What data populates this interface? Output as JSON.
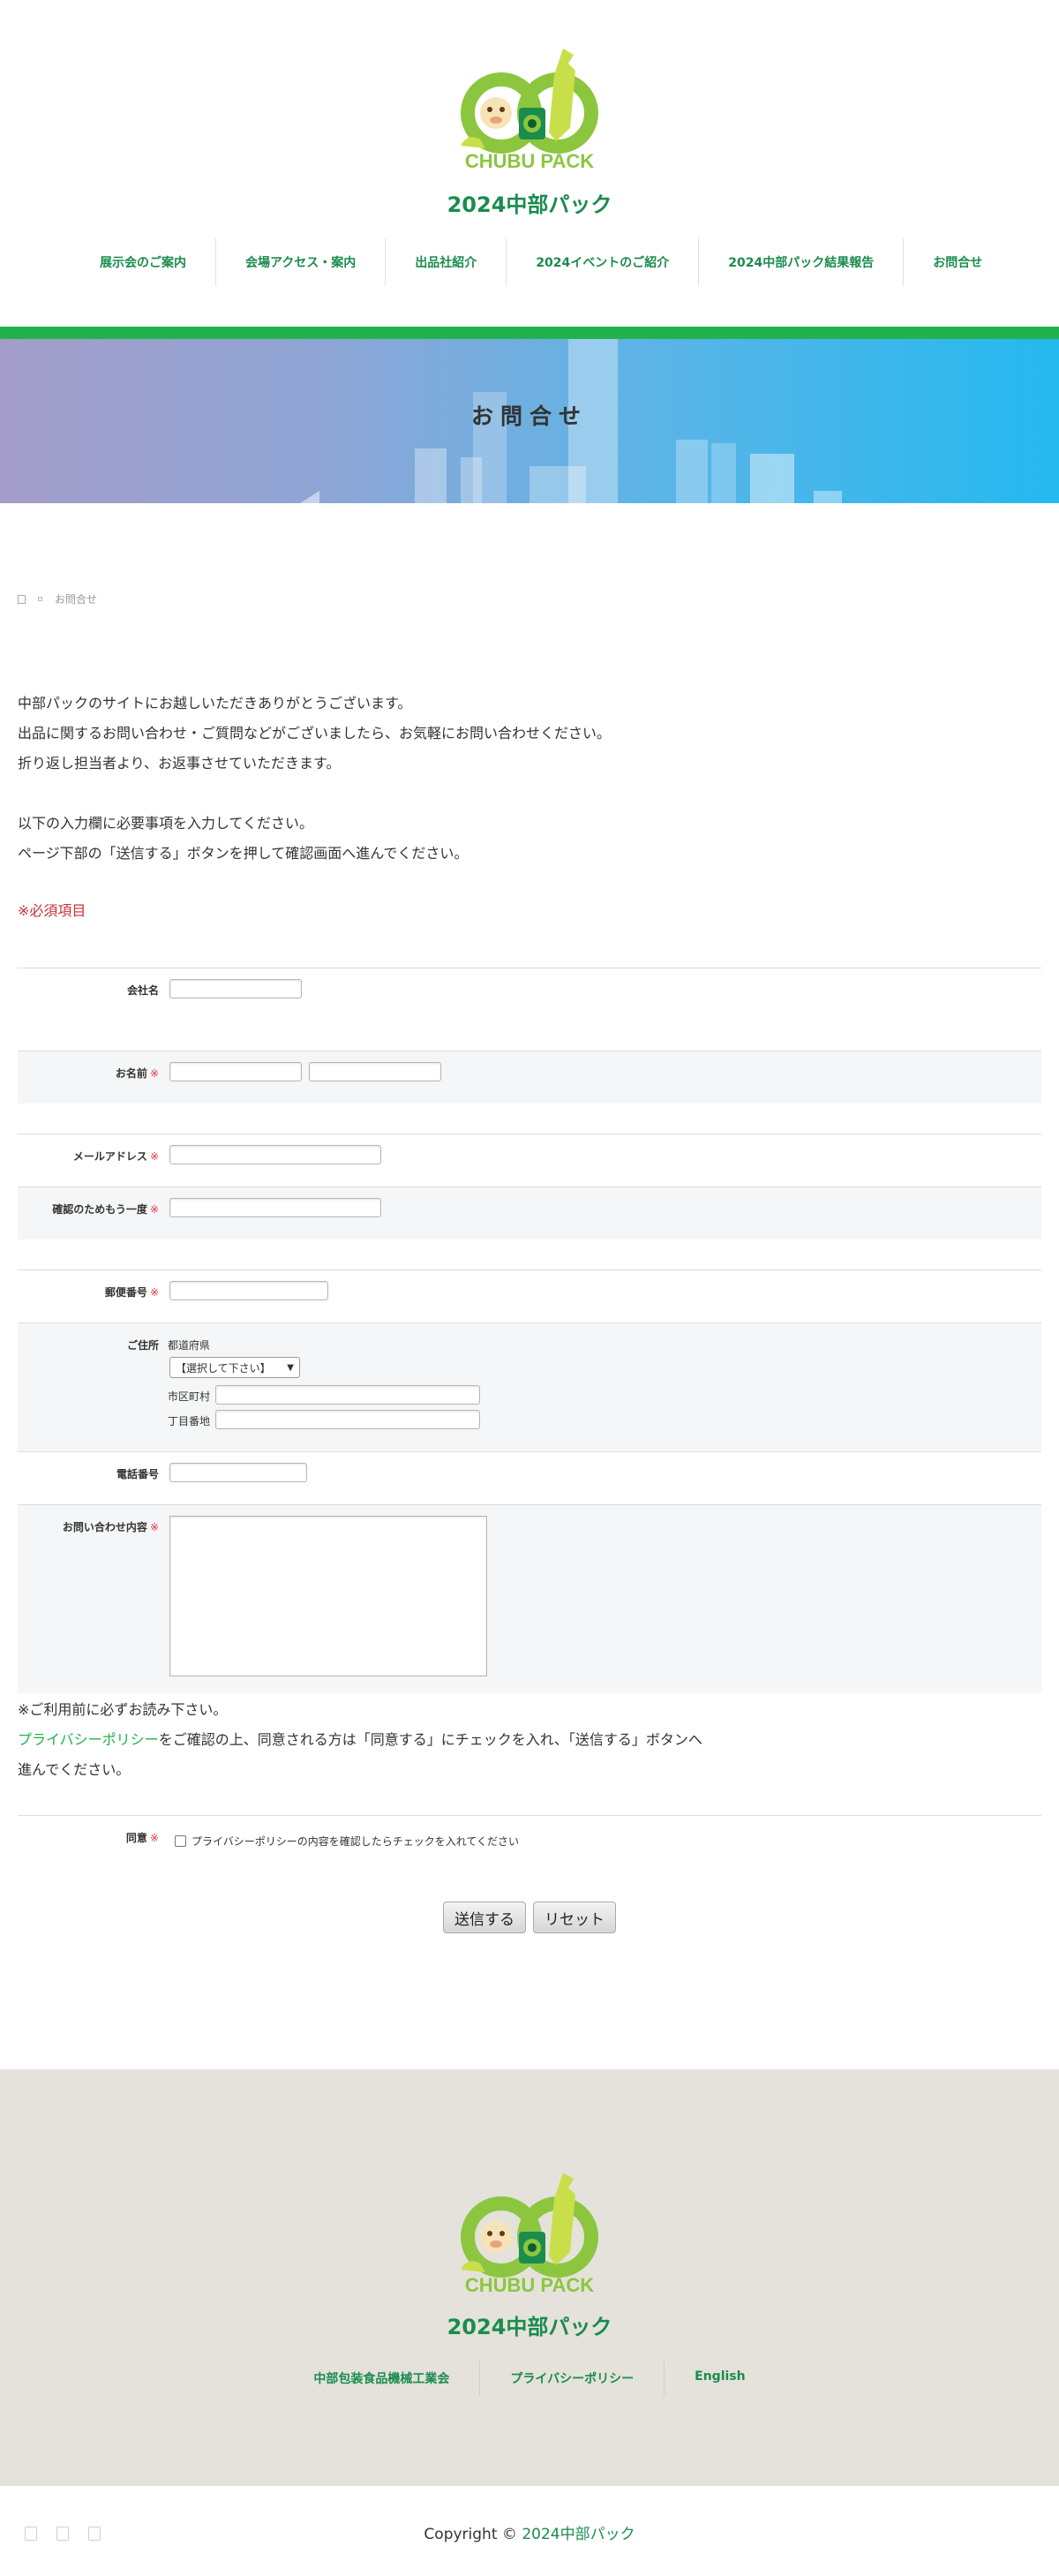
{
  "site": {
    "logo_text": "CHUBU PACK",
    "title": "2024中部パック"
  },
  "nav": [
    {
      "label": "展示会のご案内"
    },
    {
      "label": "会場アクセス・案内"
    },
    {
      "label": "出品社紹介"
    },
    {
      "label": "2024イベントのご紹介"
    },
    {
      "label": "2024中部パック結果報告"
    },
    {
      "label": "お問合せ"
    }
  ],
  "hero": {
    "title": "お問合せ"
  },
  "breadcrumb": {
    "home_icon": "home-icon",
    "separator_icon": "chevron-right-icon",
    "current": "お問合せ"
  },
  "intro": {
    "lines": [
      "中部パックのサイトにお越しいただきありがとうございます。",
      "出品に関するお問い合わせ・ご質問などがございましたら、お気軽にお問い合わせください。",
      "折り返し担当者より、お返事させていただきます。",
      "",
      "以下の入力欄に必要事項を入力してください。",
      "ページ下部の「送信する」ボタンを押して確認画面へ進んでください。"
    ],
    "required_note": "※必須項目"
  },
  "form": {
    "required_mark": "※",
    "company": {
      "label": "会社名"
    },
    "name": {
      "label": "お名前"
    },
    "email": {
      "label": "メールアドレス"
    },
    "email_confirm": {
      "label": "確認のためもう一度"
    },
    "zip": {
      "label": "郵便番号"
    },
    "address": {
      "label": "ご住所",
      "prefecture_label": "都道府県",
      "prefecture_selected": "【選択して下さい】",
      "city_label": "市区町村",
      "street_label": "丁目番地"
    },
    "phone": {
      "label": "電話番号"
    },
    "message": {
      "label": "お問い合わせ内容"
    },
    "agree": {
      "label": "同意",
      "checkbox_text": "プライバシーポリシーの内容を確認したらチェックを入れてください"
    }
  },
  "privacy": {
    "line1": "※ご利用前に必ずお読み下さい。",
    "link": "プライバシーポリシー",
    "line2_rest": "をご確認の上、同意される方は「同意する」にチェックを入れ、「送信する」ボタンへ",
    "line3": "進んでください。"
  },
  "buttons": {
    "submit": "送信する",
    "reset": "リセット"
  },
  "footer": {
    "title": "2024中部パック",
    "links": [
      {
        "label": "中部包装食品機械工業会"
      },
      {
        "label": "プライバシーポリシー"
      },
      {
        "label": "English"
      }
    ],
    "copyright_prefix": "Copyright ©",
    "copyright_name": "2024中部パック"
  },
  "colors": {
    "brand_green": "#1a8c4e",
    "accent_green": "#21b24b",
    "required_red": "#e0323f",
    "footer_bg": "#e4e2db"
  }
}
